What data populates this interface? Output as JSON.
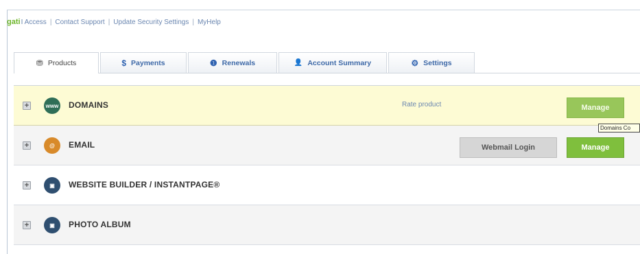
{
  "topbar": {
    "brand": "gati",
    "links": [
      "I Access",
      "Contact Support",
      "Update Security Settings",
      "MyHelp"
    ],
    "separator": "|"
  },
  "tabs": [
    {
      "label": "Products",
      "icon": "gift-icon",
      "glyph": "⛃",
      "active": true
    },
    {
      "label": "Payments",
      "icon": "dollar-icon",
      "glyph": "$",
      "active": false
    },
    {
      "label": "Renewals",
      "icon": "info-icon",
      "glyph": "❶",
      "active": false
    },
    {
      "label": "Account Summary",
      "icon": "user-icon",
      "glyph": "👤",
      "active": false
    },
    {
      "label": "Settings",
      "icon": "gear-icon",
      "glyph": "⚙",
      "active": false
    }
  ],
  "products": [
    {
      "title": "DOMAINS",
      "icon": "www-globe-icon",
      "icon_text": "www",
      "rate_link": "Rate product",
      "manage_label": "Manage",
      "highlight": true
    },
    {
      "title": "EMAIL",
      "icon": "email-icon",
      "icon_text": "@",
      "webmail_label": "Webmail Login",
      "manage_label": "Manage"
    },
    {
      "title": "WEBSITE BUILDER / INSTANTPAGE®",
      "icon": "website-builder-icon",
      "icon_text": "▣"
    },
    {
      "title": "PHOTO ALBUM",
      "icon": "photo-album-icon",
      "icon_text": "▣"
    }
  ],
  "tooltip": "Domains Co",
  "colors": {
    "accent_green": "#7fbf3d",
    "link_blue": "#6a86b0",
    "highlight_row": "#fdfbd4"
  }
}
